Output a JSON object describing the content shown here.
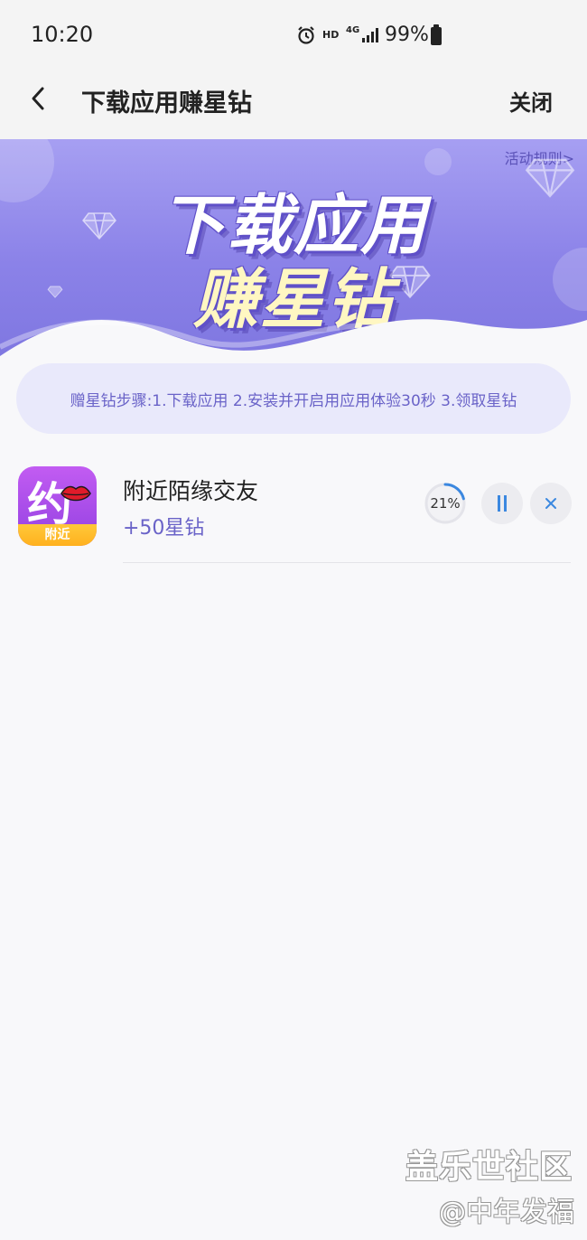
{
  "status_bar": {
    "time": "10:20",
    "hd_label": "HD",
    "network_label": "4G",
    "battery_percent": "99%",
    "icons": [
      "alarm-icon",
      "signal-icon",
      "battery-icon"
    ]
  },
  "header": {
    "title": "下载应用赚星钻",
    "close_label": "关闭",
    "back_icon": "chevron-left-icon"
  },
  "banner": {
    "rules_link": "活动规则>",
    "title_line1": "下载应用",
    "title_line2": "赚星钻",
    "decor_icons": [
      "diamond-icon"
    ]
  },
  "steps": {
    "text": "赠星钻步骤:1.下载应用 2.安装并开启用应用体验30秒 3.领取星钻"
  },
  "apps": [
    {
      "name": "附近陌缘交友",
      "reward": "+50星钻",
      "icon_char": "约",
      "icon_band_label": "附近",
      "progress_label": "21%",
      "progress_fraction": 0.21,
      "actions": [
        "pause-icon",
        "close-icon"
      ]
    }
  ],
  "watermark": {
    "main": "盖乐世社区",
    "sub": "@中年发福"
  },
  "colors": {
    "accent": "#6a63c8",
    "banner": "#8b82e8",
    "progress": "#3b88e0",
    "steps_bg": "#e9e9fb"
  }
}
